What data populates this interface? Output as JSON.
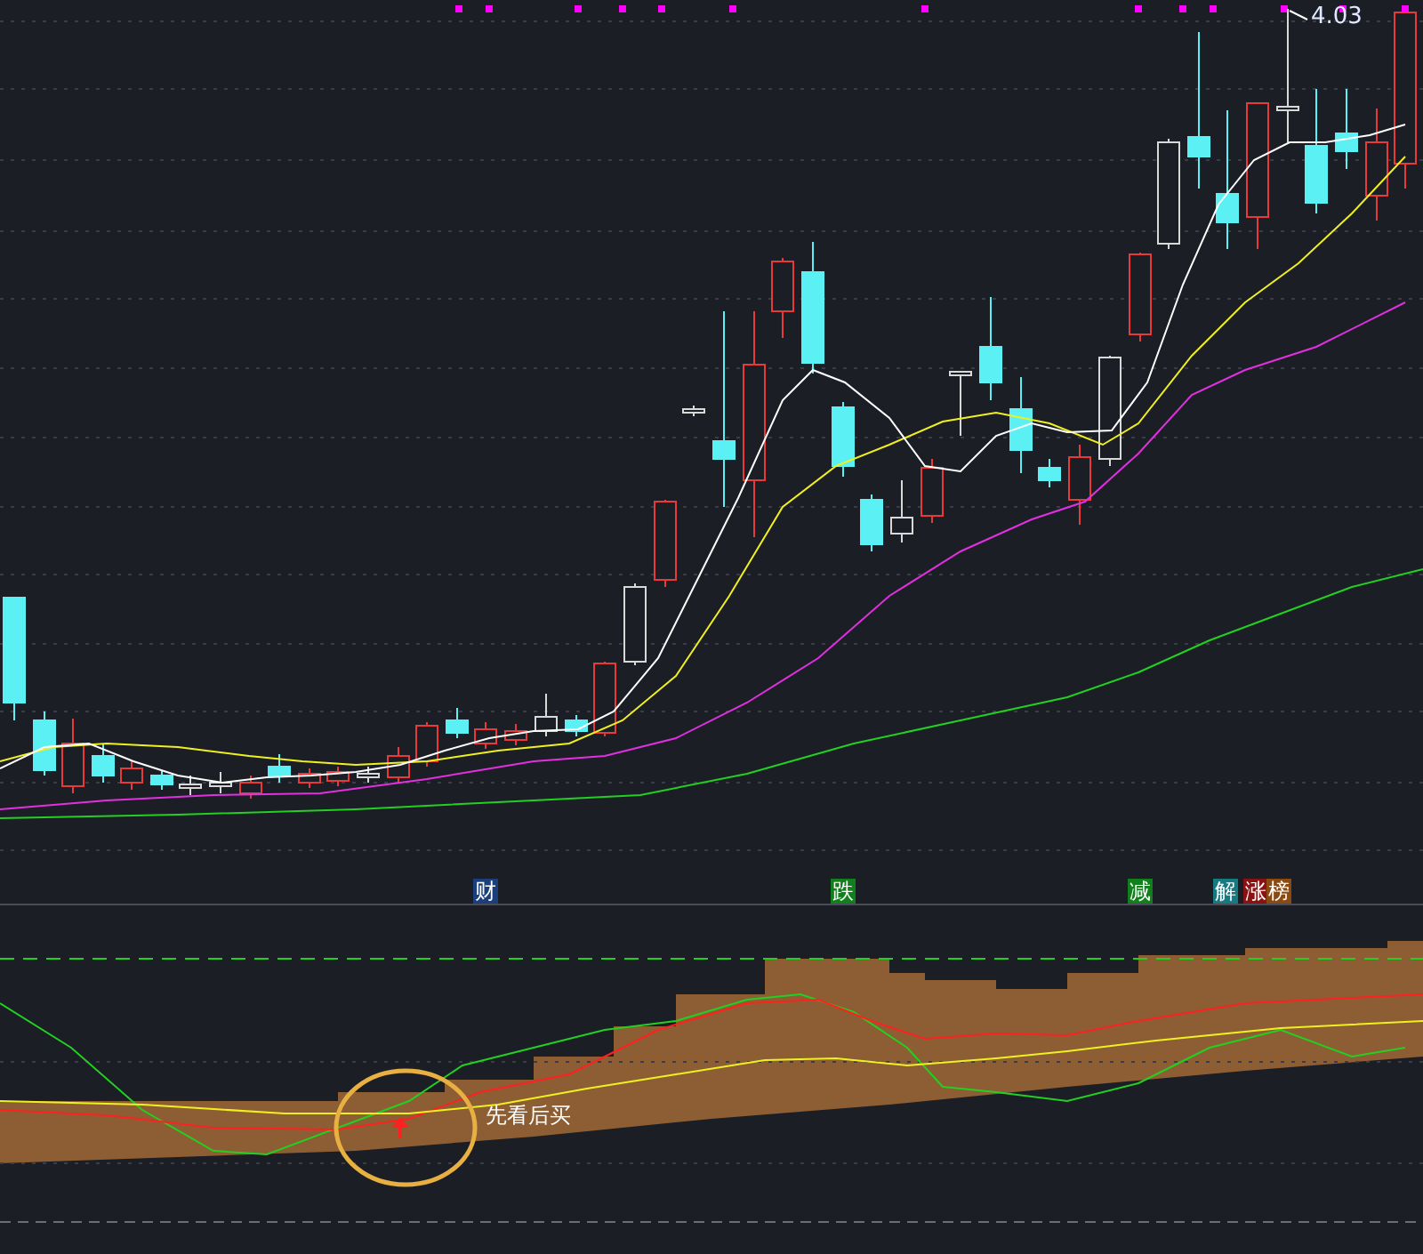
{
  "price_chart": {
    "high_label": "4.03"
  },
  "event_tags": [
    {
      "label": "财",
      "color": "#1b3f7c"
    },
    {
      "label": "跌",
      "color": "#11801c"
    },
    {
      "label": "减",
      "color": "#11801c"
    },
    {
      "label": "解",
      "color": "#177a80"
    },
    {
      "label": "涨",
      "color": "#8a1212"
    },
    {
      "label": "榜",
      "color": "#8a4a10"
    }
  ],
  "indicator_panel": {
    "signal_label": "先看后买"
  }
}
